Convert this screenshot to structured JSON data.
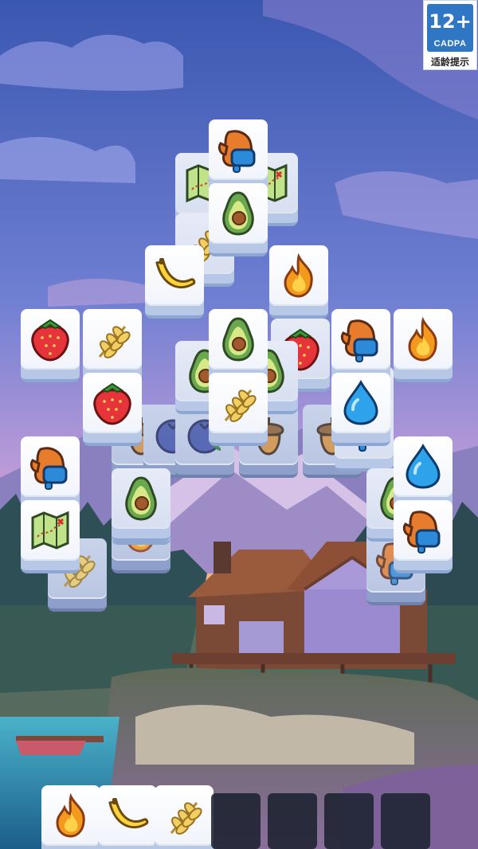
{
  "age_rating": {
    "age": "12+",
    "org": "CADPA",
    "hint": "适龄提示"
  },
  "colors": {
    "sky_top": "#3f5fb8",
    "sky_mid": "#7e8ed8",
    "sunset": "#f0a57c",
    "mountain": "#6a70a8",
    "forest": "#2d4e4a",
    "lake": "#2d8aa8",
    "tile_face": "#ffffff",
    "tile_base": "#b7c7e6",
    "tray_slot": "#1c2230"
  },
  "board": {
    "tiles": [
      {
        "item": "acorn-icon",
        "layer": 0
      },
      {
        "item": "blueberry-icon",
        "layer": 0
      },
      {
        "item": "blueberry-icon",
        "layer": 0
      },
      {
        "item": "acorn-icon",
        "layer": 0
      },
      {
        "item": "acorn-icon",
        "layer": 0
      },
      {
        "item": "fire-icon",
        "layer": 0
      },
      {
        "item": "strawberry-icon",
        "layer": 0
      },
      {
        "item": "wheat-icon",
        "layer": 0
      },
      {
        "item": "mitten-icon",
        "layer": 0
      },
      {
        "item": "map-icon",
        "layer": 1
      },
      {
        "item": "wheat-icon",
        "layer": 1
      },
      {
        "item": "avocado-icon",
        "layer": 1
      },
      {
        "item": "strawberry-icon",
        "layer": 1
      },
      {
        "item": "map-icon",
        "layer": 1
      },
      {
        "item": "avocado-icon",
        "layer": 1
      },
      {
        "item": "avocado-icon",
        "layer": 1
      },
      {
        "item": "mitten-icon",
        "layer": 1
      },
      {
        "item": "avocado-icon",
        "layer": 1
      },
      {
        "item": "fire-icon",
        "layer": 1
      },
      {
        "item": "avocado-icon",
        "layer": 1
      },
      {
        "item": "mitten-icon",
        "layer": 2
      },
      {
        "item": "avocado-icon",
        "layer": 2
      },
      {
        "item": "banana-icon",
        "layer": 2
      },
      {
        "item": "fire-icon",
        "layer": 2
      },
      {
        "item": "strawberry-icon",
        "layer": 2
      },
      {
        "item": "wheat-icon",
        "layer": 2
      },
      {
        "item": "avocado-icon",
        "layer": 2
      },
      {
        "item": "mitten-icon",
        "layer": 2
      },
      {
        "item": "fire-icon",
        "layer": 2
      },
      {
        "item": "strawberry-icon",
        "layer": 2
      },
      {
        "item": "wheat-icon",
        "layer": 2
      },
      {
        "item": "water-drop-icon",
        "layer": 2
      },
      {
        "item": "mitten-icon",
        "layer": 2
      },
      {
        "item": "water-drop-icon",
        "layer": 2
      },
      {
        "item": "map-icon",
        "layer": 2
      },
      {
        "item": "mitten-icon",
        "layer": 2
      }
    ]
  },
  "tray": {
    "capacity": 7,
    "items": [
      "fire-icon",
      "banana-icon",
      "wheat-icon"
    ]
  }
}
